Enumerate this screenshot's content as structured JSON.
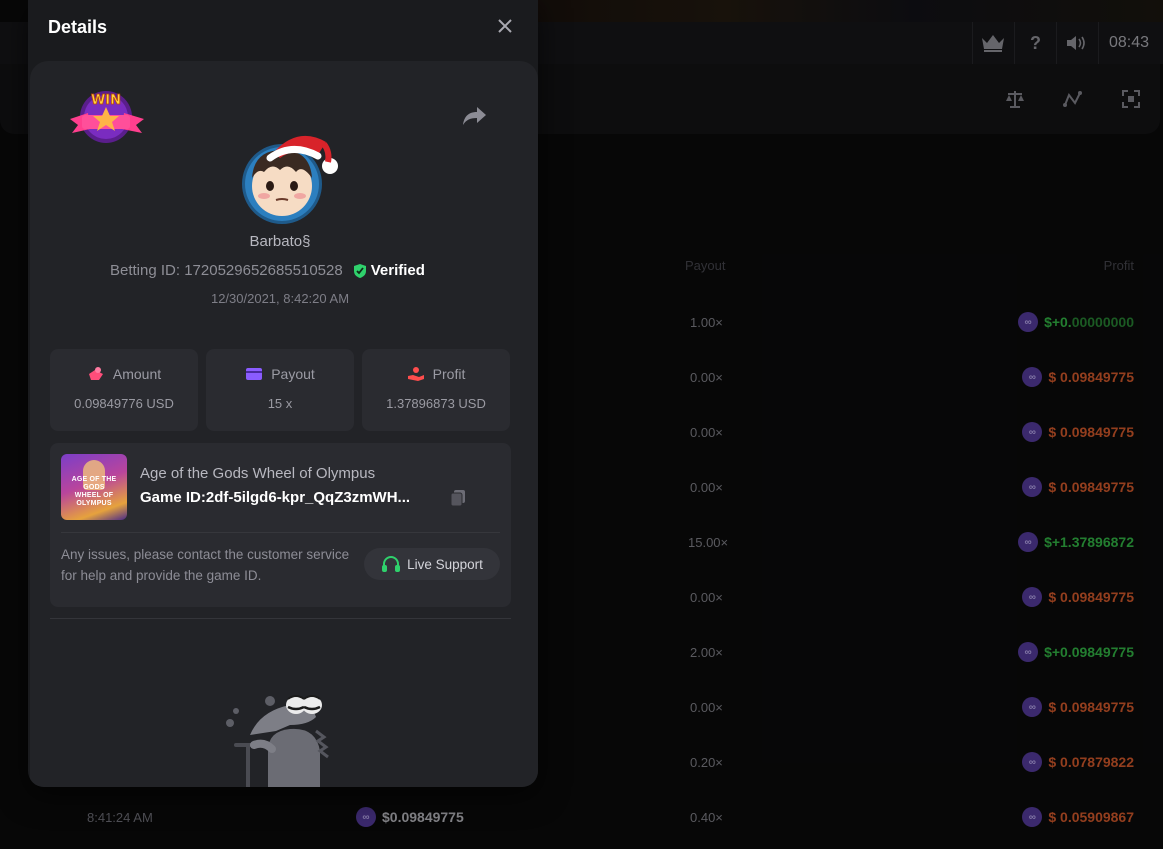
{
  "topbar": {
    "time": "08:43",
    "icons": [
      "crown-icon",
      "help-icon",
      "volume-icon"
    ]
  },
  "toolbar_icons": [
    "balance-icon",
    "chart-icon",
    "fullscreen-icon"
  ],
  "table": {
    "headers": {
      "payout": "Payout",
      "profit": "Profit"
    },
    "rows": [
      {
        "payout": "1.00×",
        "profit_sign": "$+0.",
        "profit_rest": "00000000",
        "type": "pos"
      },
      {
        "payout": "0.00×",
        "profit": "$  0.09849775",
        "type": "neg"
      },
      {
        "payout": "0.00×",
        "profit": "$  0.09849775",
        "type": "neg"
      },
      {
        "payout": "0.00×",
        "profit": "$  0.09849775",
        "type": "neg"
      },
      {
        "payout": "15.00×",
        "profit": "$+1.37896872",
        "type": "pos"
      },
      {
        "payout": "0.00×",
        "profit": "$  0.09849775",
        "type": "neg"
      },
      {
        "payout": "2.00×",
        "profit": "$+0.09849775",
        "type": "pos"
      },
      {
        "payout": "0.00×",
        "profit": "$  0.09849775",
        "type": "neg"
      },
      {
        "payout": "0.20×",
        "profit": "$  0.07879822",
        "type": "neg"
      },
      {
        "payout": "0.40×",
        "profit": "$  0.05909867",
        "type": "neg",
        "time": "8:41:24 AM",
        "amount": "$0.09849775"
      }
    ]
  },
  "modal": {
    "title": "Details",
    "close_label": "×",
    "win_badge_text": "WIN",
    "username": "Barbato§",
    "betting_id_label": "Betting ID: 1720529652685510528",
    "verified_label": "Verified",
    "date": "12/30/2021, 8:42:20 AM",
    "stats": [
      {
        "label": "Amount",
        "value": "0.09849776 USD",
        "icon": "amount-icon",
        "color": "#ff4d7a"
      },
      {
        "label": "Payout",
        "value": "15 x",
        "icon": "payout-card-icon",
        "color": "#8a5cff"
      },
      {
        "label": "Profit",
        "value": "1.37896873 USD",
        "icon": "profit-hand-icon",
        "color": "#ff4d4d"
      }
    ],
    "game": {
      "name": "Age of the Gods Wheel of Olympus",
      "game_id": "Game ID:2df-5ilgd6-kpr_QqZ3zmWH...",
      "thumb_text": "AGE OF THE GODS\nWHEEL OF OLYMPUS"
    },
    "support_text": "Any issues, please contact the customer service for help and provide the game ID.",
    "support_button": "Live Support"
  },
  "colors": {
    "positive": "#36c24a",
    "negative": "#e2602e",
    "verified": "#2fd16c",
    "support_icon": "#2fd16c"
  }
}
